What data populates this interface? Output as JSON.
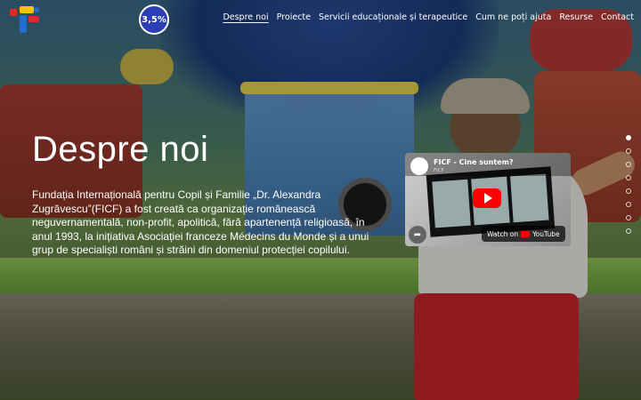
{
  "header": {
    "badge_text": "3,5%"
  },
  "nav": {
    "items": [
      {
        "label": "Despre noi",
        "active": true
      },
      {
        "label": "Proiecte",
        "active": false
      },
      {
        "label": "Servicii educaționale și terapeutice",
        "active": false
      },
      {
        "label": "Cum ne poți ajuta",
        "active": false
      },
      {
        "label": "Resurse",
        "active": false
      },
      {
        "label": "Contact",
        "active": false
      }
    ]
  },
  "hero": {
    "title": "Despre noi",
    "description": "Fundația Internațională pentru Copil și Familie „Dr. Alexandra Zugrăvescu”(FICF) a fost creată ca organizație românească neguvernamentală, non-profit, apolitică, fără apartenență religioasă, în anul 1993, la inițiativa Asociației franceze Médecins du Monde și a unui grup de specialiști români și străini din domeniul protecției copilului."
  },
  "video": {
    "title": "FICF - Cine suntem?",
    "channel": "FICF",
    "watch_label": "Watch on",
    "platform": "YouTube"
  },
  "slider": {
    "dot_count": 8,
    "active_index": 0
  },
  "colors": {
    "badge": "#2b3eb4",
    "logo_red": "#e5262b",
    "logo_yellow": "#f5c400",
    "logo_blue": "#1f6fd1",
    "youtube_red": "#ff0000"
  }
}
